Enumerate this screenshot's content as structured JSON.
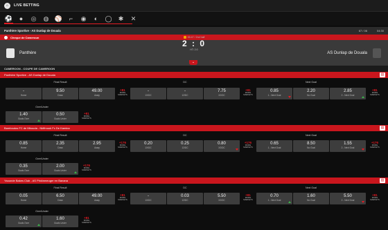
{
  "header": {
    "title": "LIVE BETTING"
  },
  "sports": [
    "football-icon",
    "basketball-icon",
    "tennis-icon",
    "volleyball-icon",
    "baseball-icon",
    "hockey-icon",
    "handball-icon",
    "table-tennis-icon",
    "cricket-icon",
    "badminton-icon",
    "esports-icon"
  ],
  "match": {
    "name": "Panthère Sportive - AS Dunlap de Douala",
    "counter": "67 / 06",
    "time": "04:30",
    "competition": "Cheque de Cameroun",
    "home": "Panthère",
    "away": "AS Dunlap de Douala",
    "period": "55:47 / 2nd half",
    "score": "2 : 0",
    "ht": "HT: 2:0"
  },
  "league": "CAMEROON - COUPE DE CAMEROON",
  "events": [
    {
      "name": "Panthère Sportive - AS Dunlap de Douala",
      "markets": {
        "final_result": {
          "title": "Final Result",
          "odds": [
            {
              "v": "-",
              "l": "Home"
            },
            {
              "v": "9.50",
              "l": "Draw"
            },
            {
              "v": "49.00",
              "l": "Away"
            }
          ],
          "more": "+81"
        },
        "dc": {
          "title": "DC",
          "odds": [
            {
              "v": "-",
              "l": "1X/DC"
            },
            {
              "v": "-",
              "l": "12/DC"
            },
            {
              "v": "7.75",
              "l": "X2/DC"
            }
          ],
          "more": "+81"
        },
        "next_goal": {
          "title": "Next Goal",
          "odds": [
            {
              "v": "0.85",
              "l": "1 - Next Goal"
            },
            {
              "v": "2.20",
              "l": "No Goal"
            },
            {
              "v": "2.85",
              "l": "2 - Next Goal"
            }
          ],
          "more": "+81"
        },
        "over_under": {
          "title": "Over/Under",
          "odds": [
            {
              "v": "1.40",
              "l": "Goals Over"
            },
            {
              "v": "0.50",
              "l": "Goals Under"
            }
          ],
          "more": "+81"
        }
      }
    },
    {
      "name": "Bamboutos FC de Mbouda - Nkffmouk Fc De Kamina",
      "markets": {
        "final_result": {
          "title": "Final Result",
          "odds": [
            {
              "v": "0.85",
              "l": "Home"
            },
            {
              "v": "2.35",
              "l": "Draw"
            },
            {
              "v": "2.95",
              "l": "Away"
            }
          ],
          "more": "+176"
        },
        "dc": {
          "title": "DC",
          "odds": [
            {
              "v": "0.20",
              "l": "1X/DC"
            },
            {
              "v": "0.25",
              "l": "12/DC"
            },
            {
              "v": "0.80",
              "l": "X2/DC"
            }
          ],
          "more": "+176"
        },
        "next_goal": {
          "title": "Next Goal",
          "odds": [
            {
              "v": "0.65",
              "l": "1 - Next Goal"
            },
            {
              "v": "8.50",
              "l": "No Goal"
            },
            {
              "v": "1.55",
              "l": "2 - Next Goal"
            }
          ],
          "more": "+176"
        },
        "over_under": {
          "title": "Over/Under",
          "odds": [
            {
              "v": "0.35",
              "l": "Goals Over"
            },
            {
              "v": "2.00",
              "l": "Goals Under"
            }
          ],
          "more": "+176"
        }
      }
    },
    {
      "name": "Yaounde Bakes Club - AS Pinkinmeuger en Banana",
      "markets": {
        "final_result": {
          "title": "Final Result",
          "odds": [
            {
              "v": "0.05",
              "l": "Home"
            },
            {
              "v": "6.50",
              "l": "Draw"
            },
            {
              "v": "49.00",
              "l": "Away"
            }
          ],
          "more": "+81"
        },
        "dc": {
          "title": "DC",
          "odds": [
            {
              "v": "-",
              "l": "1X/DC"
            },
            {
              "v": "0.03",
              "l": "12/DC"
            },
            {
              "v": "5.50",
              "l": "X2/DC"
            }
          ],
          "more": "+81"
        },
        "next_goal": {
          "title": "Next Goal",
          "odds": [
            {
              "v": "0.70",
              "l": "1 - Next Goal"
            },
            {
              "v": "1.60",
              "l": "No Goal"
            },
            {
              "v": "5.50",
              "l": "2 - Next Goal"
            }
          ],
          "more": "+81"
        },
        "over_under": {
          "title": "Over/Under",
          "odds": [
            {
              "v": "0.42",
              "l": "Goals Over"
            },
            {
              "v": "1.60",
              "l": "Goals Under"
            }
          ],
          "more": "+81"
        }
      }
    }
  ],
  "more_label": "MORE MARKETS",
  "colors": {
    "accent": "#c9161d",
    "tile": "#3d3d3d",
    "bg": "#0d0d0d"
  }
}
